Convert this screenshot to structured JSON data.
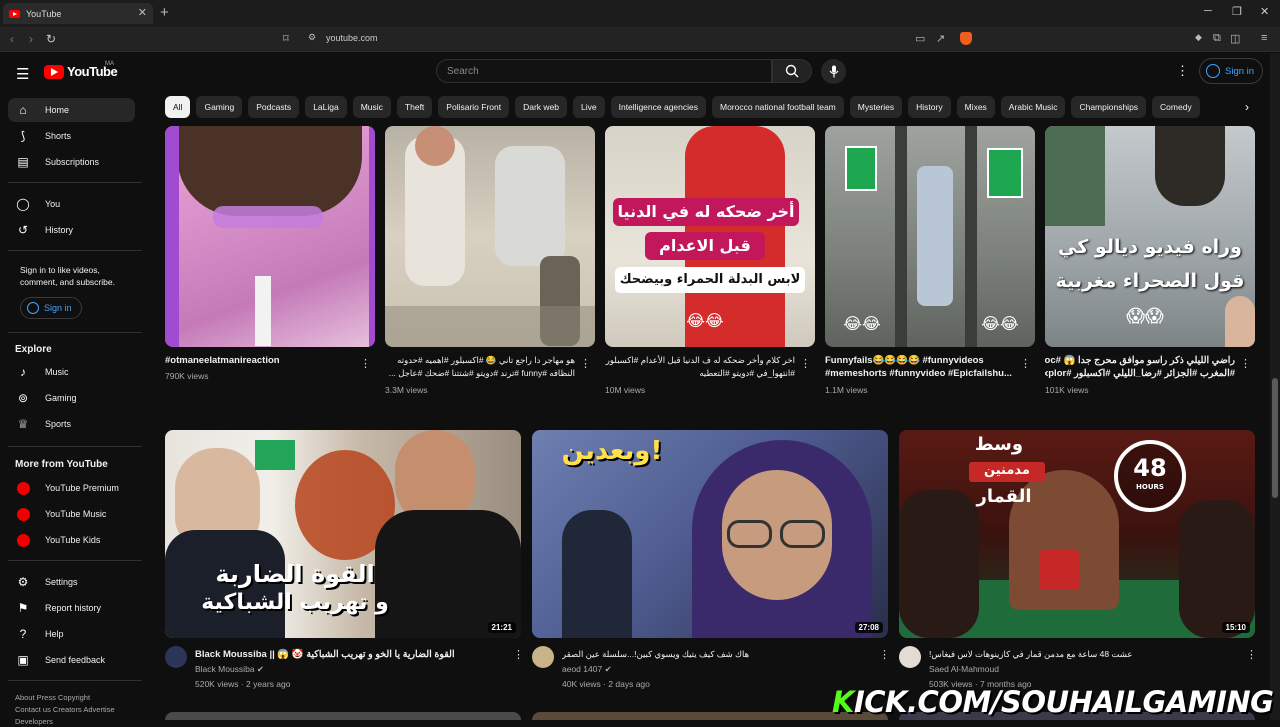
{
  "browser": {
    "tab_title": "YouTube",
    "url": "youtube.com"
  },
  "masthead": {
    "logo_text": "YouTube",
    "country_code": "MA",
    "search_placeholder": "Search",
    "signin_label": "Sign in"
  },
  "sidebar": {
    "main": [
      {
        "label": "Home",
        "icon": "home-icon",
        "active": true
      },
      {
        "label": "Shorts",
        "icon": "shorts-icon"
      },
      {
        "label": "Subscriptions",
        "icon": "subscriptions-icon"
      }
    ],
    "you": [
      {
        "label": "You",
        "icon": "user-circle-icon"
      },
      {
        "label": "History",
        "icon": "history-icon"
      }
    ],
    "signin_prompt": "Sign in to like videos, comment, and subscribe.",
    "signin_label": "Sign in",
    "explore_heading": "Explore",
    "explore": [
      {
        "label": "Music",
        "icon": "music-note-icon"
      },
      {
        "label": "Gaming",
        "icon": "gamepad-icon"
      },
      {
        "label": "Sports",
        "icon": "trophy-icon"
      }
    ],
    "more_heading": "More from YouTube",
    "more": [
      {
        "label": "YouTube Premium",
        "icon": "youtube-premium-icon"
      },
      {
        "label": "YouTube Music",
        "icon": "youtube-music-icon"
      },
      {
        "label": "YouTube Kids",
        "icon": "youtube-kids-icon"
      }
    ],
    "settings": [
      {
        "label": "Settings",
        "icon": "gear-icon"
      },
      {
        "label": "Report history",
        "icon": "flag-icon"
      },
      {
        "label": "Help",
        "icon": "help-icon"
      },
      {
        "label": "Send feedback",
        "icon": "feedback-icon"
      }
    ],
    "footer_line1": "About  Press  Copyright",
    "footer_line2": "Contact us  Creators  Advertise",
    "footer_line3": "Developers"
  },
  "chips": [
    "All",
    "Gaming",
    "Podcasts",
    "LaLiga",
    "Music",
    "Theft",
    "Polisario Front",
    "Dark web",
    "Live",
    "Intelligence agencies",
    "Morocco national football team",
    "Mysteries",
    "History",
    "Mixes",
    "Arabic Music",
    "Championships",
    "Comedy"
  ],
  "shorts": [
    {
      "title": "#otmaneelatmanireaction",
      "title2": "",
      "views": "790K views"
    },
    {
      "title": "هو مهاجر دا راجع تاني 😂 #اكسبلور #اهميه #حدوته",
      "title2": "النظافه #funny #ترند #دويتو #شتتنا #ضحك #عاجل ...",
      "views": "3.3M views"
    },
    {
      "title": "اخر كلام وأخر ضحكه له ف الدنيا قبل الأعدام #اكسبلور",
      "title2": "#انتهوا_في #دويتو #التعطيه",
      "views": "10M views"
    },
    {
      "title": "Funnyfails😂😂😂😂 #funnyvideos",
      "title2": "#memeshorts #funnyvideo #Epicfailshu...",
      "views": "1.1M views"
    },
    {
      "title": "راضي الليلي ذكر راسو موافق محرج جدا 😱 #moroc",
      "title2": "#المغرب #الجزائر #رضا_الليلي #اكسبلور #explor...",
      "views": "101K views"
    }
  ],
  "short_overlays": {
    "s3_line1": "أخر ضحكه له في الدنيا",
    "s3_line2": "قبل الاعدام",
    "s3_line3": "لابس البدلة الحمراء وبيضحك",
    "s3_emoji": "😂😂",
    "s4_emoji_left": "😂😂",
    "s4_emoji_right": "😂😂",
    "s5_line1": "وراه فيديو ديالو كي",
    "s5_line2": "قول الصحراء مغربية",
    "s5_emoji": "😱😱"
  },
  "videos": [
    {
      "title": "Black Moussiba || 😱 🤡 القوة الضارية يا الخو و تهريب الشباكية",
      "channel": "Black Moussiba",
      "verified": true,
      "meta": "520K views · 2 years ago",
      "duration": "21:21",
      "overlay1": "القوة الضاربة",
      "overlay2": "و تهريب الشباكية"
    },
    {
      "title": "هاك شف كيف يتيك ويسوي كبين!...سلسلة عين الصقر",
      "channel": "aeod 1407",
      "verified": true,
      "meta": "40K views · 2 days ago",
      "duration": "27:08",
      "overlay1": "وبعدين!"
    },
    {
      "title": "عشت 48 ساعة مع مدمن قمار في كازينوهات لاس فيغاس!",
      "channel": "Saed Al-Mahmoud",
      "verified": false,
      "meta": "503K views · 7 months ago",
      "duration": "15:10",
      "overlay1": "وسط",
      "overlay2": "مدمنين",
      "overlay3": "القمار",
      "badge_num": "48",
      "badge_unit": "HOURS"
    }
  ],
  "watermark": {
    "first": "K",
    "rest": "ICK.COM/SOUHAILGAMING"
  }
}
